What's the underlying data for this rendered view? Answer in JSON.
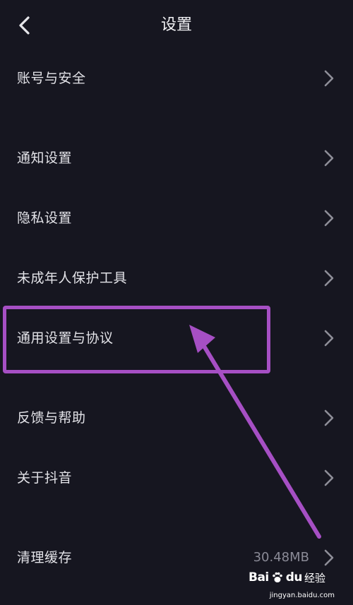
{
  "header": {
    "title": "设置"
  },
  "rows": [
    {
      "label": "账号与安全",
      "value": ""
    },
    {
      "label": "通知设置",
      "value": ""
    },
    {
      "label": "隐私设置",
      "value": ""
    },
    {
      "label": "未成年人保护工具",
      "value": ""
    },
    {
      "label": "通用设置与协议",
      "value": ""
    },
    {
      "label": "反馈与帮助",
      "value": ""
    },
    {
      "label": "关于抖音",
      "value": ""
    },
    {
      "label": "清理缓存",
      "value": "30.48MB"
    }
  ],
  "annotation": {
    "color": "#a64fc4"
  },
  "watermark": {
    "brand": "Bai",
    "brand_suffix": "du",
    "text": "经验",
    "url": "jingyan.baidu.com"
  },
  "colors": {
    "background": "#161620",
    "text": "#e3e3e8",
    "secondary_text": "#8a8a96",
    "chevron": "#8e8e98",
    "annotation": "#a64fc4"
  }
}
